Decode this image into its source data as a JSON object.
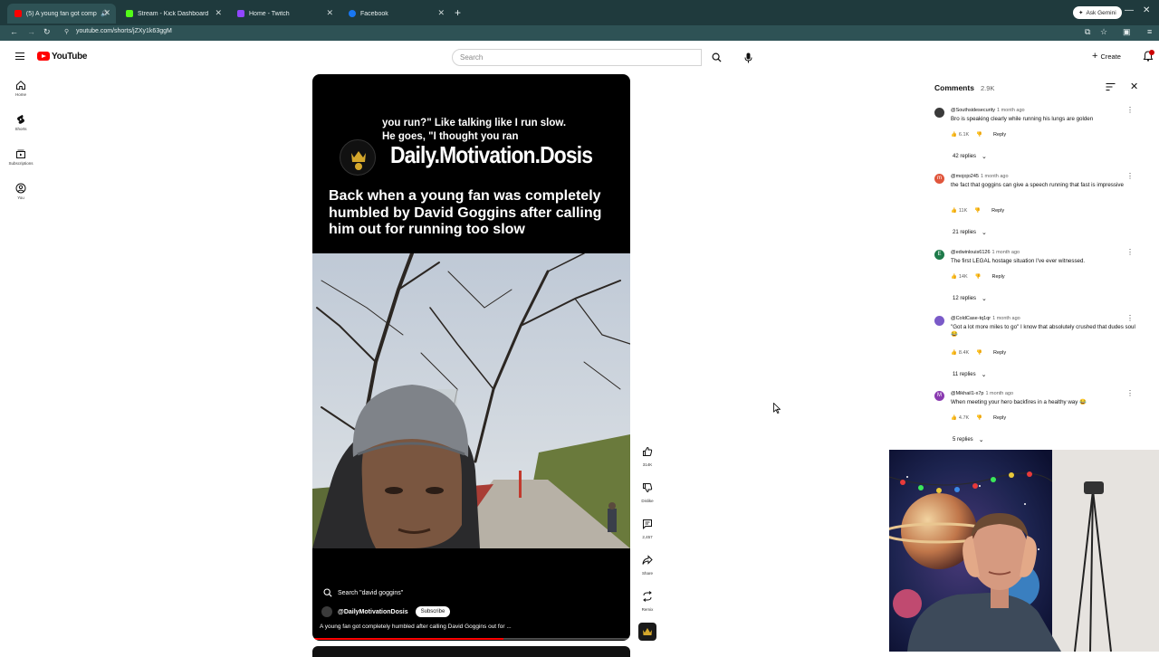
{
  "browser": {
    "tabs": [
      {
        "title": "(5) A young fan got compl",
        "active": true,
        "color": "#ff0000"
      },
      {
        "title": "Stream - Kick Dashboard",
        "active": false,
        "color": "#53fc18"
      },
      {
        "title": "Home - Twitch",
        "active": false,
        "color": "#9146ff"
      },
      {
        "title": "Facebook",
        "active": false,
        "color": "#1877f2"
      }
    ],
    "new_tab": "+",
    "ask_gemini": "Ask Gemini",
    "url": "youtube.com/shorts/jZXy1k63ggM"
  },
  "youtube": {
    "wordmark": "YouTube",
    "search_placeholder": "Search",
    "create_label": "Create",
    "rail": [
      {
        "label": "Home",
        "icon": "home-icon"
      },
      {
        "label": "Shorts",
        "icon": "shorts-icon"
      },
      {
        "label": "Subscriptions",
        "icon": "subscriptions-icon"
      },
      {
        "label": "You",
        "icon": "you-icon"
      }
    ]
  },
  "short": {
    "caption_line1": "you run?\" Like talking like I run slow.",
    "caption_line2": "He goes, \"I thought you ran",
    "brand_name": "Daily.Motivation.Dosis",
    "headline": "Back when a young fan was completely humbled by David Goggins after calling him out for running too slow",
    "search_chip": "Search \"david goggins\"",
    "channel": "@DailyMotivationDosis",
    "subscribe_label": "Subscribe",
    "title": "A young fan got completely humbled after calling David Goggins out for ...",
    "progress": 0.6,
    "actions": [
      {
        "label": "314K",
        "icon": "like-icon"
      },
      {
        "label": "Dislike",
        "icon": "dislike-icon"
      },
      {
        "label": "2,457",
        "icon": "comment-icon"
      },
      {
        "label": "Share",
        "icon": "share-icon"
      },
      {
        "label": "Remix",
        "icon": "remix-icon"
      }
    ]
  },
  "comments_panel": {
    "title": "Comments",
    "count": "2.9K",
    "reply_label": "Reply",
    "items": [
      {
        "user": "@Southsidesecurity",
        "ago": "1 month ago",
        "text": "Bro is speaking clearly while running his lungs are golden",
        "likes": "6.1K",
        "replies": "42 replies",
        "avatar": "",
        "avatar_color": "#3a3a3a"
      },
      {
        "user": "@mojojo245",
        "ago": "1 month ago",
        "text": "the fact that goggins can give a speech running that fast is impressive",
        "likes": "11K",
        "replies": "21 replies",
        "avatar": "m",
        "avatar_color": "#e0563c"
      },
      {
        "user": "@edwinlouis6126",
        "ago": "1 month ago",
        "text": "The first LEGAL hostage situation I've ever witnessed.",
        "likes": "14K",
        "replies": "12 replies",
        "avatar": "E",
        "avatar_color": "#1e7a4a"
      },
      {
        "user": "@ColdCase-tq1qr",
        "ago": "1 month ago",
        "text": "\"Got a lot more miles to go\" I know that absolutely crushed that dudes soul 😂",
        "likes": "8.4K",
        "replies": "11 replies",
        "avatar": "",
        "avatar_color": "#7a5ac8"
      },
      {
        "user": "@Mikhail1-x7p",
        "ago": "1 month ago",
        "text": "When meeting your hero backfires in a healthy way 😂",
        "likes": "4.7K",
        "replies": "5 replies",
        "avatar": "M",
        "avatar_color": "#8a3ab0"
      }
    ]
  }
}
